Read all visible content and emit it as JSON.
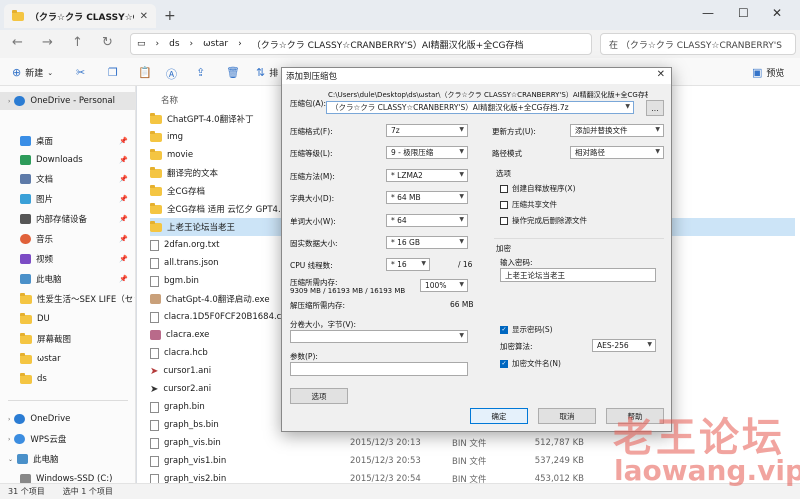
{
  "colors": {
    "accent": "#0067c0",
    "selection": "#cce4f7",
    "folder": "#f4c542",
    "watermark": "#e65a50"
  },
  "window": {
    "tab_title": "（クラ☆クラ CLASSY☆CRANB",
    "new_tab": "+",
    "minimize": "—",
    "maximize": "☐",
    "close": "✕"
  },
  "nav": {
    "back": "←",
    "forward": "→",
    "up": "↑",
    "refresh": "↻",
    "breadcrumb": [
      "ds",
      "ωstar",
      "（クラ☆クラ CLASSY☆CRANBERRY'S）AI精翻汉化版+全CG存档"
    ],
    "more": "›",
    "search_text": "在 （クラ☆クラ CLASSY☆CRANBERRY'S"
  },
  "toolbar": {
    "new_label": "新建",
    "sort_label": "排",
    "preview_label": "预览"
  },
  "sidebar": {
    "items": [
      {
        "label": "OneDrive - Personal",
        "icon": "cloud-icon",
        "selected": true
      },
      {
        "label": "桌面",
        "icon": "desktop-icon",
        "pinned": true
      },
      {
        "label": "Downloads",
        "icon": "download-icon",
        "pinned": true
      },
      {
        "label": "文档",
        "icon": "document-icon",
        "pinned": true
      },
      {
        "label": "图片",
        "icon": "picture-icon",
        "pinned": true
      },
      {
        "label": "内部存储设备",
        "icon": "storage-icon",
        "pinned": true
      },
      {
        "label": "音乐",
        "icon": "music-icon",
        "pinned": true
      },
      {
        "label": "视频",
        "icon": "video-icon",
        "pinned": true
      },
      {
        "label": "此电脑",
        "icon": "computer-icon",
        "pinned": true
      },
      {
        "label": "性爱生活～SEX LIFE（セックス",
        "icon": "folder-icon",
        "pinned": false
      },
      {
        "label": "DU",
        "icon": "folder-icon"
      },
      {
        "label": "屏幕截图",
        "icon": "folder-icon"
      },
      {
        "label": "ωstar",
        "icon": "folder-icon"
      },
      {
        "label": "ds",
        "icon": "folder-icon"
      },
      {
        "label": "OneDrive",
        "icon": "cloud-icon"
      },
      {
        "label": "WPS云盘",
        "icon": "cloud-icon"
      },
      {
        "label": "此电脑",
        "icon": "computer-icon"
      },
      {
        "label": "Windows-SSD (C:)",
        "icon": "drive-icon"
      }
    ]
  },
  "filelist": {
    "col_name": "名称",
    "rows": [
      {
        "name": "ChatGPT-4.0翻译补丁",
        "kind": "folder"
      },
      {
        "name": "img",
        "kind": "folder"
      },
      {
        "name": "movie",
        "kind": "folder"
      },
      {
        "name": "翻译完的文本",
        "kind": "folder"
      },
      {
        "name": "全CG存档",
        "kind": "folder"
      },
      {
        "name": "全CG存档 适用 云忆夕 GPT4.0",
        "kind": "folder"
      },
      {
        "name": "上老王论坛当老王",
        "kind": "folder",
        "selected": true
      },
      {
        "name": "2dfan.org.txt",
        "kind": "file"
      },
      {
        "name": "all.trans.json",
        "kind": "file"
      },
      {
        "name": "bgm.bin",
        "kind": "file"
      },
      {
        "name": "ChatGpt-4.0翻译启动.exe",
        "kind": "file"
      },
      {
        "name": "clacra.1D5F0FCF20B1684.crash.",
        "kind": "file"
      },
      {
        "name": "clacra.exe",
        "kind": "file"
      },
      {
        "name": "clacra.hcb",
        "kind": "file"
      },
      {
        "name": "cursor1.ani",
        "kind": "file"
      },
      {
        "name": "cursor2.ani",
        "kind": "file"
      },
      {
        "name": "graph.bin",
        "kind": "file"
      },
      {
        "name": "graph_bs.bin",
        "kind": "file"
      },
      {
        "name": "graph_vis.bin",
        "kind": "file",
        "date": "2015/12/3 20:13",
        "type": "BIN 文件",
        "size": "512,787 KB"
      },
      {
        "name": "graph_vis1.bin",
        "kind": "file",
        "date": "2015/12/3 20:53",
        "type": "BIN 文件",
        "size": "537,249 KB"
      },
      {
        "name": "graph_vis2.bin",
        "kind": "file",
        "date": "2015/12/3 20:54",
        "type": "BIN 文件",
        "size": "453,012 KB"
      }
    ]
  },
  "status": {
    "count": "31 个项目",
    "selected": "选中 1 个项目"
  },
  "dialog": {
    "title": "添加到压缩包",
    "archive_label": "压缩包(A):",
    "archive_path": "C:\\Users\\dule\\Desktop\\ds\\ωstar\\（クラ☆クラ CLASSY☆CRANBERRY'S）AI精翻汉化版+全CG存档\\",
    "archive_name": "（クラ☆クラ CLASSY☆CRANBERRY'S）AI精翻汉化版+全CG存档.7z",
    "browse": "...",
    "format_label": "压缩格式(F):",
    "format": "7z",
    "level_label": "压缩等级(L):",
    "level": "9 - 极限压缩",
    "method_label": "压缩方法(M):",
    "method": "* LZMA2",
    "dict_label": "字典大小(D):",
    "dict": "* 64 MB",
    "word_label": "单词大小(W):",
    "word": "* 64",
    "solid_label": "固实数据大小:",
    "solid": "* 16 GB",
    "cpu_label": "CPU 线程数:",
    "cpu": "* 16",
    "cpu_total": "/ 16",
    "mem_label": "压缩所需内存:",
    "mem_value": "9309 MB / 16193 MB / 16193 MB",
    "mem_pct": "100%",
    "decomp_label": "解压缩所需内存:",
    "decomp_value": "66 MB",
    "split_label": "分卷大小，字节(V):",
    "params_label": "参数(P):",
    "options_btn": "选项",
    "update_label": "更新方式(U):",
    "update": "添加并替换文件",
    "pathmode_label": "路径模式",
    "pathmode": "相对路径",
    "options_group": "选项",
    "opt_sfx": "创建自释放程序(X)",
    "opt_shared": "压缩共享文件",
    "opt_delete": "操作完成后删除源文件",
    "encrypt_group": "加密",
    "password_label": "输入密码:",
    "password": "上老王论坛当老王",
    "show_pwd": "显示密码(S)",
    "enc_method_label": "加密算法:",
    "enc_method": "AES-256",
    "encrypt_names": "加密文件名(N)",
    "ok": "确定",
    "cancel": "取消",
    "help": "帮助"
  },
  "watermark": {
    "cn": "老王论坛",
    "en": "laowang.vip"
  }
}
